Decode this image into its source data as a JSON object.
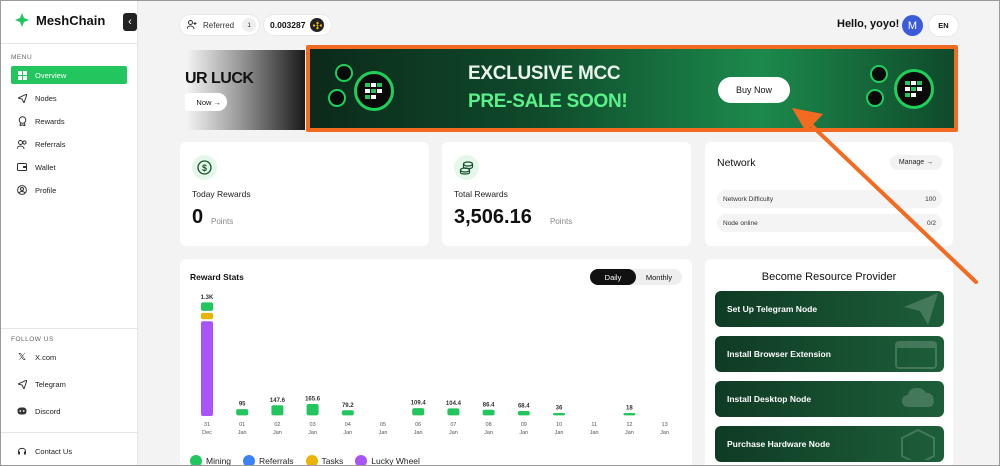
{
  "sidebar": {
    "brand": "MeshChain",
    "menu_heading": "MENU",
    "items": [
      {
        "label": "Overview",
        "icon": "grid-icon",
        "active": true
      },
      {
        "label": "Nodes",
        "icon": "send-icon"
      },
      {
        "label": "Rewards",
        "icon": "award-icon"
      },
      {
        "label": "Referrals",
        "icon": "users-icon"
      },
      {
        "label": "Wallet",
        "icon": "wallet-icon"
      },
      {
        "label": "Profile",
        "icon": "profile-icon"
      }
    ],
    "follow_heading": "FOLLOW US",
    "social": [
      {
        "label": "X.com",
        "icon": "x-icon"
      },
      {
        "label": "Telegram",
        "icon": "telegram-icon"
      },
      {
        "label": "Discord",
        "icon": "discord-icon"
      }
    ],
    "contact": "Contact Us"
  },
  "header": {
    "referred_label": "Referred",
    "referred_count": "1",
    "balance": "0.003287",
    "greeting": "Hello, yoyo!",
    "avatar_initial": "M",
    "language": "EN"
  },
  "banners": {
    "prev_title": "OUR LUCK",
    "prev_button": "Now →",
    "main_title": "EXCLUSIVE MCC",
    "main_subtitle": "PRE-SALE SOON!",
    "buy_button": "Buy Now"
  },
  "today_rewards": {
    "label": "Today Rewards",
    "value": "0",
    "unit": "Points"
  },
  "total_rewards": {
    "label": "Total Rewards",
    "value": "3,506.16",
    "unit": "Points"
  },
  "network": {
    "title": "Network",
    "manage_button": "Manage →",
    "rows": [
      {
        "label": "Network Difficulty",
        "value": "100"
      },
      {
        "label": "Node online",
        "value": "0/2"
      }
    ]
  },
  "reward_stats": {
    "title": "Reward Stats",
    "toggle": [
      "Daily",
      "Monthly"
    ],
    "active_toggle": "Daily"
  },
  "chart_data": {
    "type": "bar",
    "title": "Reward Stats",
    "stacked": true,
    "categories": [
      "31 Dec",
      "01 Jan",
      "02 Jan",
      "03 Jan",
      "04 Jan",
      "05 Jan",
      "06 Jan",
      "07 Jan",
      "08 Jan",
      "09 Jan",
      "10 Jan",
      "11 Jan",
      "12 Jan",
      "13 Jan"
    ],
    "value_labels": [
      "1.3K",
      "95",
      "147.6",
      "165.6",
      "79.2",
      "",
      "109.4",
      "104.4",
      "86.4",
      "68.4",
      "36",
      "",
      "18",
      ""
    ],
    "totals": [
      1300,
      95,
      147.6,
      165.6,
      79.2,
      0,
      109.4,
      104.4,
      86.4,
      68.4,
      36,
      0,
      18,
      0
    ],
    "series": [
      {
        "name": "Mining",
        "color": "#22c55e",
        "values": [
          100,
          95,
          147.6,
          165.6,
          79.2,
          0,
          109.4,
          104.4,
          86.4,
          68.4,
          36,
          0,
          18,
          0
        ]
      },
      {
        "name": "Referrals",
        "color": "#3b82f6",
        "values": [
          0,
          0,
          0,
          0,
          0,
          0,
          0,
          0,
          0,
          0,
          0,
          0,
          0,
          0
        ]
      },
      {
        "name": "Tasks",
        "color": "#eab308",
        "values": [
          80,
          0,
          0,
          0,
          0,
          0,
          0,
          0,
          0,
          0,
          0,
          0,
          0,
          0
        ]
      },
      {
        "name": "Lucky Wheel",
        "color": "#a855f7",
        "values": [
          1120,
          0,
          0,
          0,
          0,
          0,
          0,
          0,
          0,
          0,
          0,
          0,
          0,
          0
        ]
      }
    ]
  },
  "resource_provider": {
    "title": "Become Resource Provider",
    "buttons": [
      "Set Up Telegram Node",
      "Install Browser Extension",
      "Install Desktop Node",
      "Purchase Hardware Node"
    ]
  },
  "colors": {
    "accent": "#22c55e",
    "annotation": "#f36b21"
  }
}
